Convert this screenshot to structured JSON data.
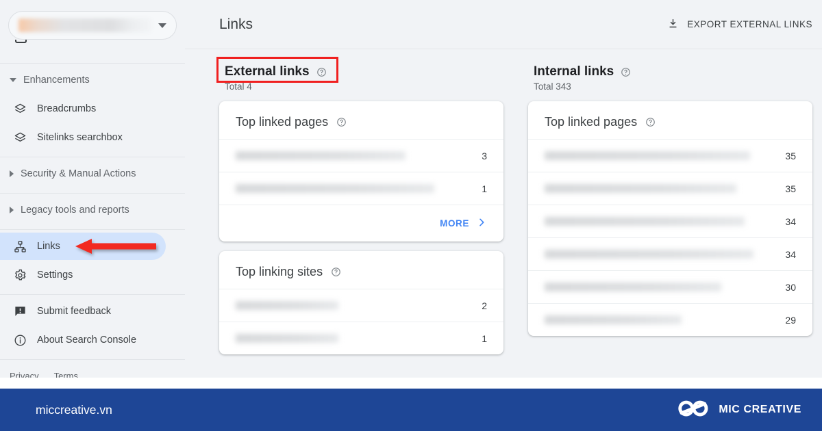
{
  "sidebar": {
    "property_selector": {
      "name": "property-selector",
      "value": "",
      "blurred": true
    },
    "groups": [
      {
        "label": "Enhancements",
        "expanded": true
      },
      {
        "label": "Security & Manual Actions",
        "expanded": false
      },
      {
        "label": "Legacy tools and reports",
        "expanded": false
      }
    ],
    "enhancement_items": [
      {
        "label": "Breadcrumbs",
        "icon": "layers-icon"
      },
      {
        "label": "Sitelinks searchbox",
        "icon": "layers-icon"
      }
    ],
    "nav_items": [
      {
        "label": "Links",
        "icon": "sitemap-icon",
        "active": true
      },
      {
        "label": "Settings",
        "icon": "gear-icon",
        "active": false
      }
    ],
    "bottom_items": [
      {
        "label": "Submit feedback",
        "icon": "feedback-icon"
      },
      {
        "label": "About Search Console",
        "icon": "info-icon"
      }
    ],
    "footer": {
      "privacy": "Privacy",
      "terms": "Terms"
    }
  },
  "header": {
    "title": "Links",
    "export_label": "EXPORT EXTERNAL LINKS",
    "export_icon": "download-icon"
  },
  "external": {
    "title": "External links",
    "total": "Total 4",
    "highlighted": true,
    "highlight_color": "#f02020",
    "cards": [
      {
        "title": "Top linked pages",
        "rows": [
          {
            "label": "",
            "value": "3",
            "blurred": true
          },
          {
            "label": "",
            "value": "1",
            "blurred": true
          }
        ],
        "more_label": "MORE",
        "has_more": true
      },
      {
        "title": "Top linking sites",
        "rows": [
          {
            "label": "",
            "value": "2",
            "blurred": true
          },
          {
            "label": "",
            "value": "1",
            "blurred": true
          }
        ],
        "has_more": false
      }
    ]
  },
  "internal": {
    "title": "Internal links",
    "total": "Total 343",
    "cards": [
      {
        "title": "Top linked pages",
        "rows": [
          {
            "label": "",
            "value": "35",
            "blurred": true
          },
          {
            "label": "",
            "value": "35",
            "blurred": true
          },
          {
            "label": "",
            "value": "34",
            "blurred": true
          },
          {
            "label": "",
            "value": "34",
            "blurred": true
          },
          {
            "label": "",
            "value": "30",
            "blurred": true
          },
          {
            "label": "",
            "value": "29",
            "blurred": true
          }
        ],
        "has_more": false
      }
    ]
  },
  "banner": {
    "url": "miccreative.vn",
    "brand": "MIC CREATIVE",
    "logo_icon": "infinity-loops-logo",
    "background_color": "#1e4696"
  }
}
